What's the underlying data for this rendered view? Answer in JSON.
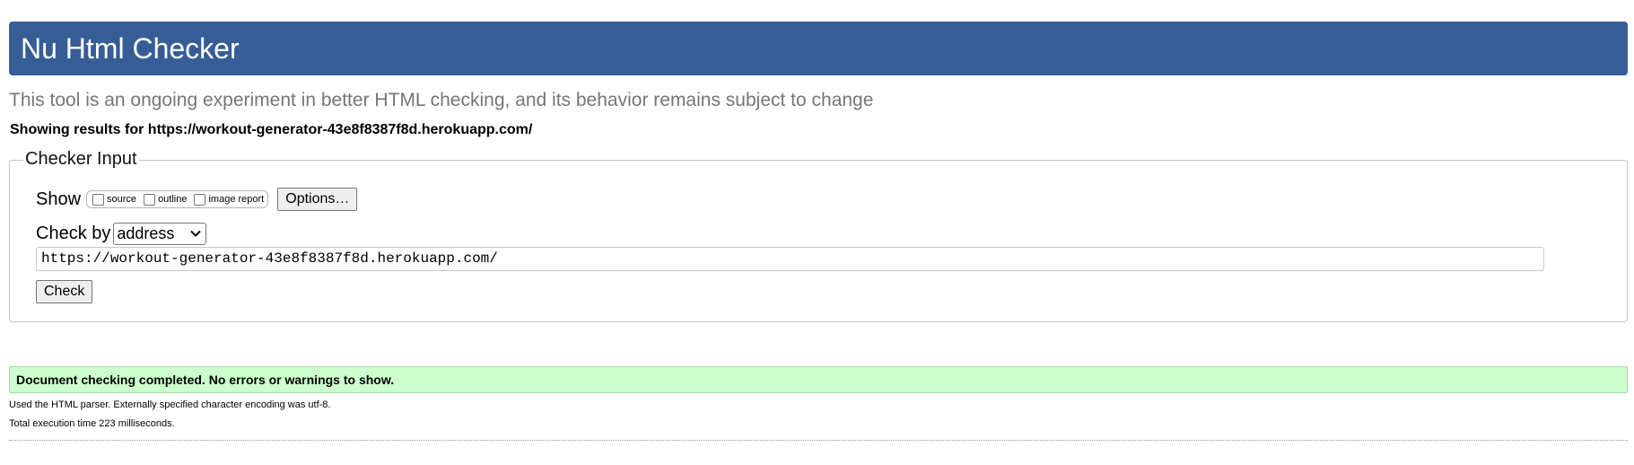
{
  "header": {
    "title": "Nu Html Checker"
  },
  "tagline": "This tool is an ongoing experiment in better HTML checking, and its behavior remains subject to change",
  "results_heading": "Showing results for https://workout-generator-43e8f8387f8d.herokuapp.com/",
  "checker_input": {
    "legend": "Checker Input",
    "show": {
      "label": "Show",
      "options": [
        {
          "label": "source",
          "checked": false
        },
        {
          "label": "outline",
          "checked": false
        },
        {
          "label": "image report",
          "checked": false
        }
      ],
      "options_button": "Options…"
    },
    "check_by": {
      "label": "Check by",
      "selected": "address"
    },
    "url_value": "https://workout-generator-43e8f8387f8d.herokuapp.com/",
    "check_button": "Check"
  },
  "result": {
    "message": "Document checking completed. No errors or warnings to show.",
    "parser_note": "Used the HTML parser. Externally specified character encoding was utf-8.",
    "execution_time": "Total execution time 223 milliseconds."
  },
  "colors": {
    "header_bg": "#365d95",
    "success_bg": "#ccffcc",
    "tagline": "#767676"
  }
}
